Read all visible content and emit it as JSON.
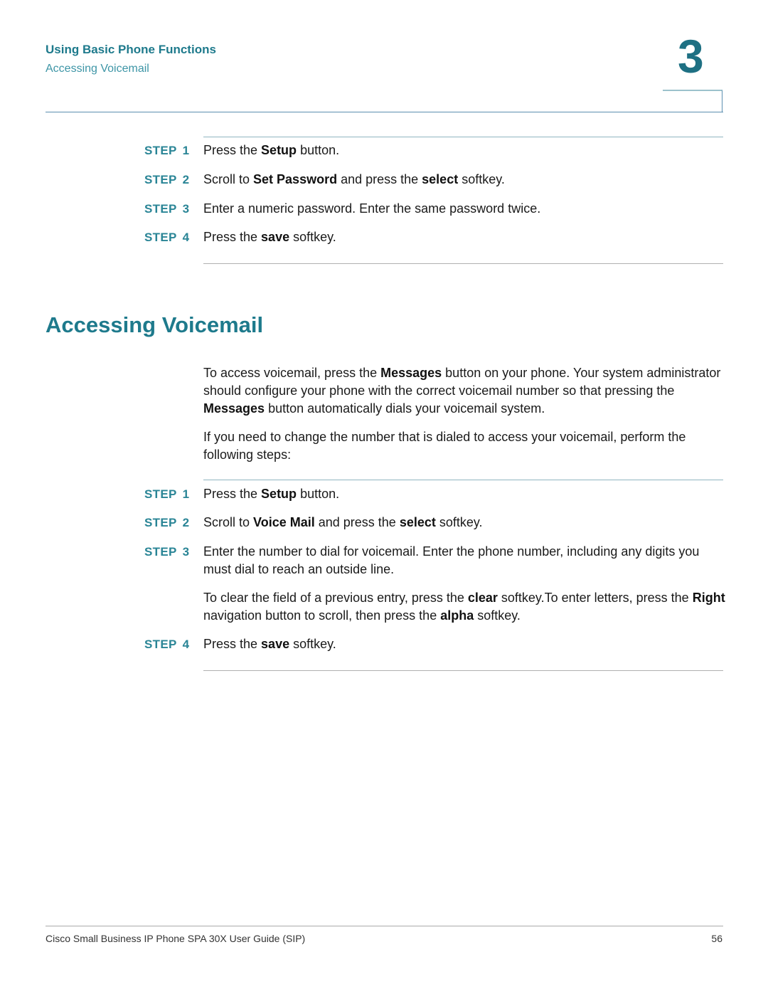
{
  "header": {
    "chapter_title": "Using Basic Phone Functions",
    "section_title": "Accessing Voicemail",
    "chapter_number": "3"
  },
  "procedure1": {
    "steps": [
      {
        "label": "STEP",
        "num": "1",
        "parts": [
          {
            "t": "Press the "
          },
          {
            "b": "Setup"
          },
          {
            "t": " button."
          }
        ]
      },
      {
        "label": "STEP",
        "num": "2",
        "parts": [
          {
            "t": "Scroll to "
          },
          {
            "b": "Set Password"
          },
          {
            "t": " and press the "
          },
          {
            "b": "select"
          },
          {
            "t": " softkey."
          }
        ]
      },
      {
        "label": "STEP",
        "num": "3",
        "parts": [
          {
            "t": "Enter a numeric password. Enter the same password twice."
          }
        ]
      },
      {
        "label": "STEP",
        "num": "4",
        "parts": [
          {
            "t": "Press the "
          },
          {
            "b": "save"
          },
          {
            "t": " softkey."
          }
        ]
      }
    ]
  },
  "section": {
    "heading": "Accessing Voicemail",
    "para1": [
      {
        "t": "To access voicemail, press the "
      },
      {
        "b": "Messages"
      },
      {
        "t": " button on your phone. Your system administrator should configure your phone with the correct voicemail number so that pressing the "
      },
      {
        "b": "Messages"
      },
      {
        "t": " button automatically dials your voicemail system."
      }
    ],
    "para2": [
      {
        "t": "If you need to change the number that is dialed to access your voicemail, perform the following steps:"
      }
    ]
  },
  "procedure2": {
    "steps": [
      {
        "label": "STEP",
        "num": "1",
        "parts": [
          {
            "t": "Press the "
          },
          {
            "b": "Setup"
          },
          {
            "t": " button."
          }
        ]
      },
      {
        "label": "STEP",
        "num": "2",
        "parts": [
          {
            "t": "Scroll to "
          },
          {
            "b": "Voice Mail"
          },
          {
            "t": " and press the "
          },
          {
            "b": "select"
          },
          {
            "t": " softkey."
          }
        ]
      },
      {
        "label": "STEP",
        "num": "3",
        "parts": [
          {
            "t": "Enter the number to dial for voicemail. Enter the phone number, including any digits you must dial to reach an outside line."
          }
        ]
      },
      {
        "label": "STEP",
        "num": "4",
        "parts": [
          {
            "t": "Press the "
          },
          {
            "b": "save"
          },
          {
            "t": " softkey."
          }
        ]
      }
    ],
    "step3_note": [
      {
        "t": "To clear the field of a previous entry, press the "
      },
      {
        "b": "clear"
      },
      {
        "t": " softkey.To enter letters, press the "
      },
      {
        "b": "Right"
      },
      {
        "t": " navigation button to scroll, then press the "
      },
      {
        "b": "alpha"
      },
      {
        "t": " softkey."
      }
    ]
  },
  "footer": {
    "title": "Cisco Small Business IP Phone SPA 30X User Guide (SIP)",
    "page": "56"
  }
}
